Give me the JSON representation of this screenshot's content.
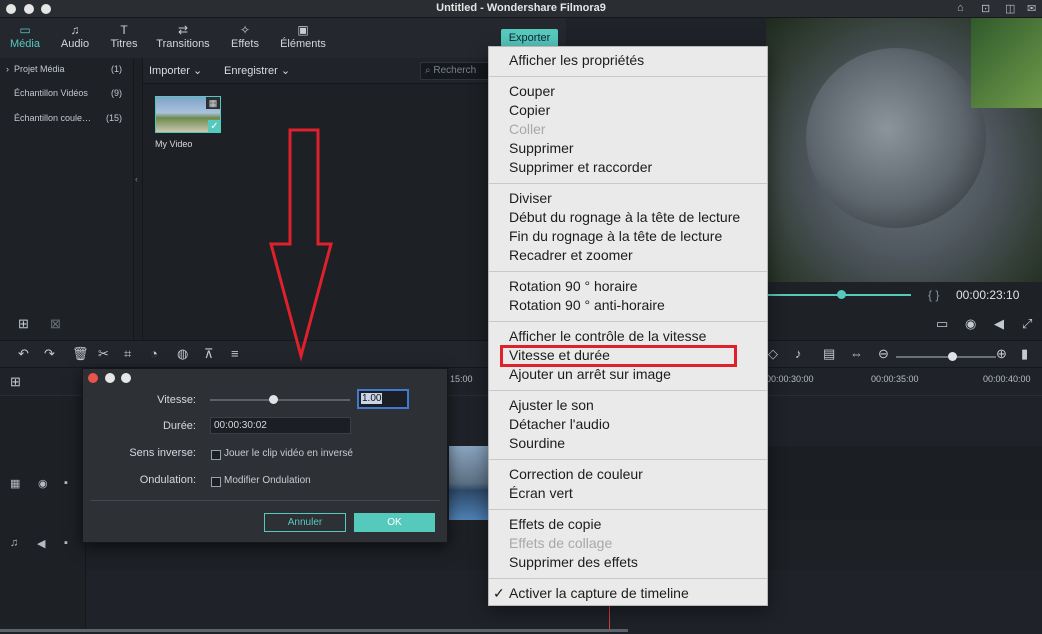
{
  "app": {
    "title": "Untitled - Wondershare Filmora9"
  },
  "tabs": [
    {
      "label": "Média",
      "icon": "folder-icon"
    },
    {
      "label": "Audio",
      "icon": "music-note-icon"
    },
    {
      "label": "Titres",
      "icon": "text-icon"
    },
    {
      "label": "Transitions",
      "icon": "transition-icon"
    },
    {
      "label": "Effets",
      "icon": "effects-icon"
    },
    {
      "label": "Éléments",
      "icon": "image-icon"
    }
  ],
  "export_label": "Exporter",
  "left_nav": [
    {
      "label": "Projet Média",
      "count": "(1)",
      "arrow": "›"
    },
    {
      "label": "Échantillon Vidéos",
      "count": "(9)"
    },
    {
      "label": "Échantillon coule…",
      "count": "(15)"
    }
  ],
  "media_toolbar": {
    "import_label": "Importer",
    "record_label": "Enregistrer",
    "search_placeholder": "Recherch"
  },
  "media_item": {
    "label": "My Video"
  },
  "preview": {
    "timecode": "00:00:23:10",
    "brackets": "{ }"
  },
  "ruler_ticks": [
    "15:00",
    "00:00:30:00",
    "00:00:35:00",
    "00:00:40:00"
  ],
  "dialog": {
    "speed_label": "Vitesse:",
    "speed_value": "1.00",
    "speed_level": 0.45,
    "duration_label": "Durée:",
    "duration_value": "00:00:30:02",
    "reverse_label": "Sens inverse:",
    "reverse_option": "Jouer le clip vidéo en inversé",
    "ripple_label": "Ondulation:",
    "ripple_option": "Modifier Ondulation",
    "cancel_label": "Annuler",
    "ok_label": "OK"
  },
  "context_menu": {
    "groups": [
      [
        {
          "label": "Afficher les propriétés"
        }
      ],
      [
        {
          "label": "Couper"
        },
        {
          "label": "Copier"
        },
        {
          "label": "Coller",
          "disabled": true
        },
        {
          "label": "Supprimer"
        },
        {
          "label": "Supprimer et raccorder"
        }
      ],
      [
        {
          "label": "Diviser"
        },
        {
          "label": "Début du rognage à la tête de lecture"
        },
        {
          "label": "Fin du rognage à la tête de lecture"
        },
        {
          "label": "Recadrer et zoomer"
        }
      ],
      [
        {
          "label": "Rotation 90 ° horaire"
        },
        {
          "label": "Rotation 90 ° anti-horaire"
        }
      ],
      [
        {
          "label": "Afficher le contrôle de la vitesse"
        },
        {
          "label": "Vitesse et durée",
          "highlighted": true
        },
        {
          "label": "Ajouter un arrêt sur image"
        }
      ],
      [
        {
          "label": "Ajuster le son"
        },
        {
          "label": "Détacher l'audio"
        },
        {
          "label": "Sourdine"
        }
      ],
      [
        {
          "label": "Correction de couleur"
        },
        {
          "label": "Écran vert"
        }
      ],
      [
        {
          "label": "Effets de copie"
        },
        {
          "label": "Effets de collage",
          "disabled": true
        },
        {
          "label": "Supprimer des effets"
        }
      ],
      [
        {
          "label": "Activer la capture de timeline",
          "checked": true
        }
      ]
    ],
    "check_glyph": "✓"
  },
  "colors": {
    "accent": "#56c9bd",
    "highlight_box": "#e0202a",
    "annotation_arrow": "#e0202a"
  }
}
